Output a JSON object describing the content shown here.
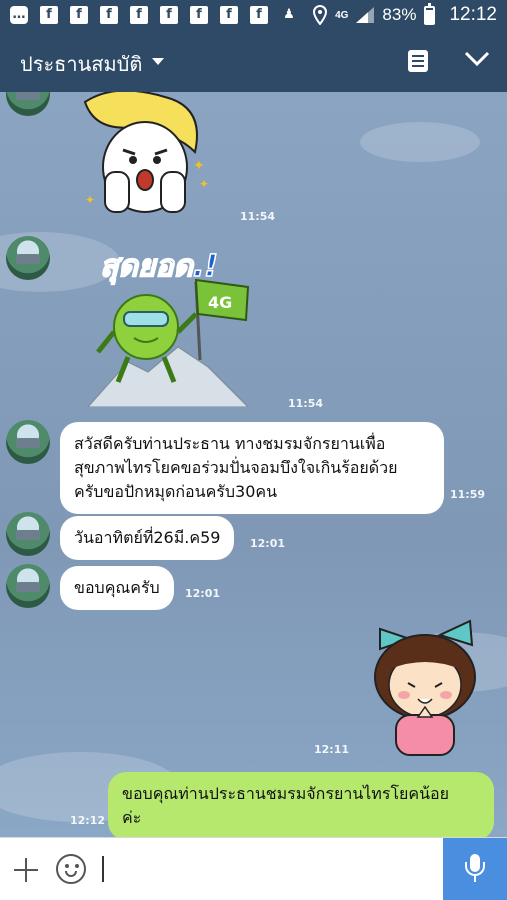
{
  "status_bar": {
    "network": "4G",
    "battery_percent": "83%",
    "battery_level": 0.83,
    "time": "12:12"
  },
  "header": {
    "title": "ประธานสมบัติ"
  },
  "messages": [
    {
      "type": "sticker",
      "sender": "other",
      "sticker": "blonde-girl-shocked",
      "time": "11:54"
    },
    {
      "type": "sticker",
      "sender": "other",
      "sticker": "4g-mascot-mountain-flag",
      "sticker_text": "สุดยอด.!",
      "flag_text": "4G",
      "time": "11:54"
    },
    {
      "type": "text",
      "sender": "other",
      "lines": [
        "สวัสดีครับท่านประธาน ทางชมรมจักรยานเพื่อ",
        "สุขภาพไทรโยคขอร่วมปั่นจอมบึงใจเกินร้อยด้วย",
        "ครับขอปักหมุดก่อนครับ30คน"
      ],
      "time": "11:59"
    },
    {
      "type": "text",
      "sender": "other",
      "lines": [
        "วันอาทิตย์ที่26มี.ค59"
      ],
      "time": "12:01"
    },
    {
      "type": "text",
      "sender": "other",
      "lines": [
        "ขอบคุณครับ"
      ],
      "time": "12:01"
    },
    {
      "type": "sticker",
      "sender": "me",
      "sticker": "girl-with-bow-praying",
      "time": "12:11"
    },
    {
      "type": "text",
      "sender": "me",
      "lines": [
        "ขอบคุณท่านประธานชมรมจักรยานไทรโยคน้อย",
        "ค่ะ"
      ],
      "time": "12:12"
    }
  ],
  "colors": {
    "header_bg": "#2f4a66",
    "chat_bg": "#7f98b6",
    "my_bubble": "#b6e86e",
    "other_bubble": "#ffffff",
    "mic_button": "#4a8ee0"
  }
}
